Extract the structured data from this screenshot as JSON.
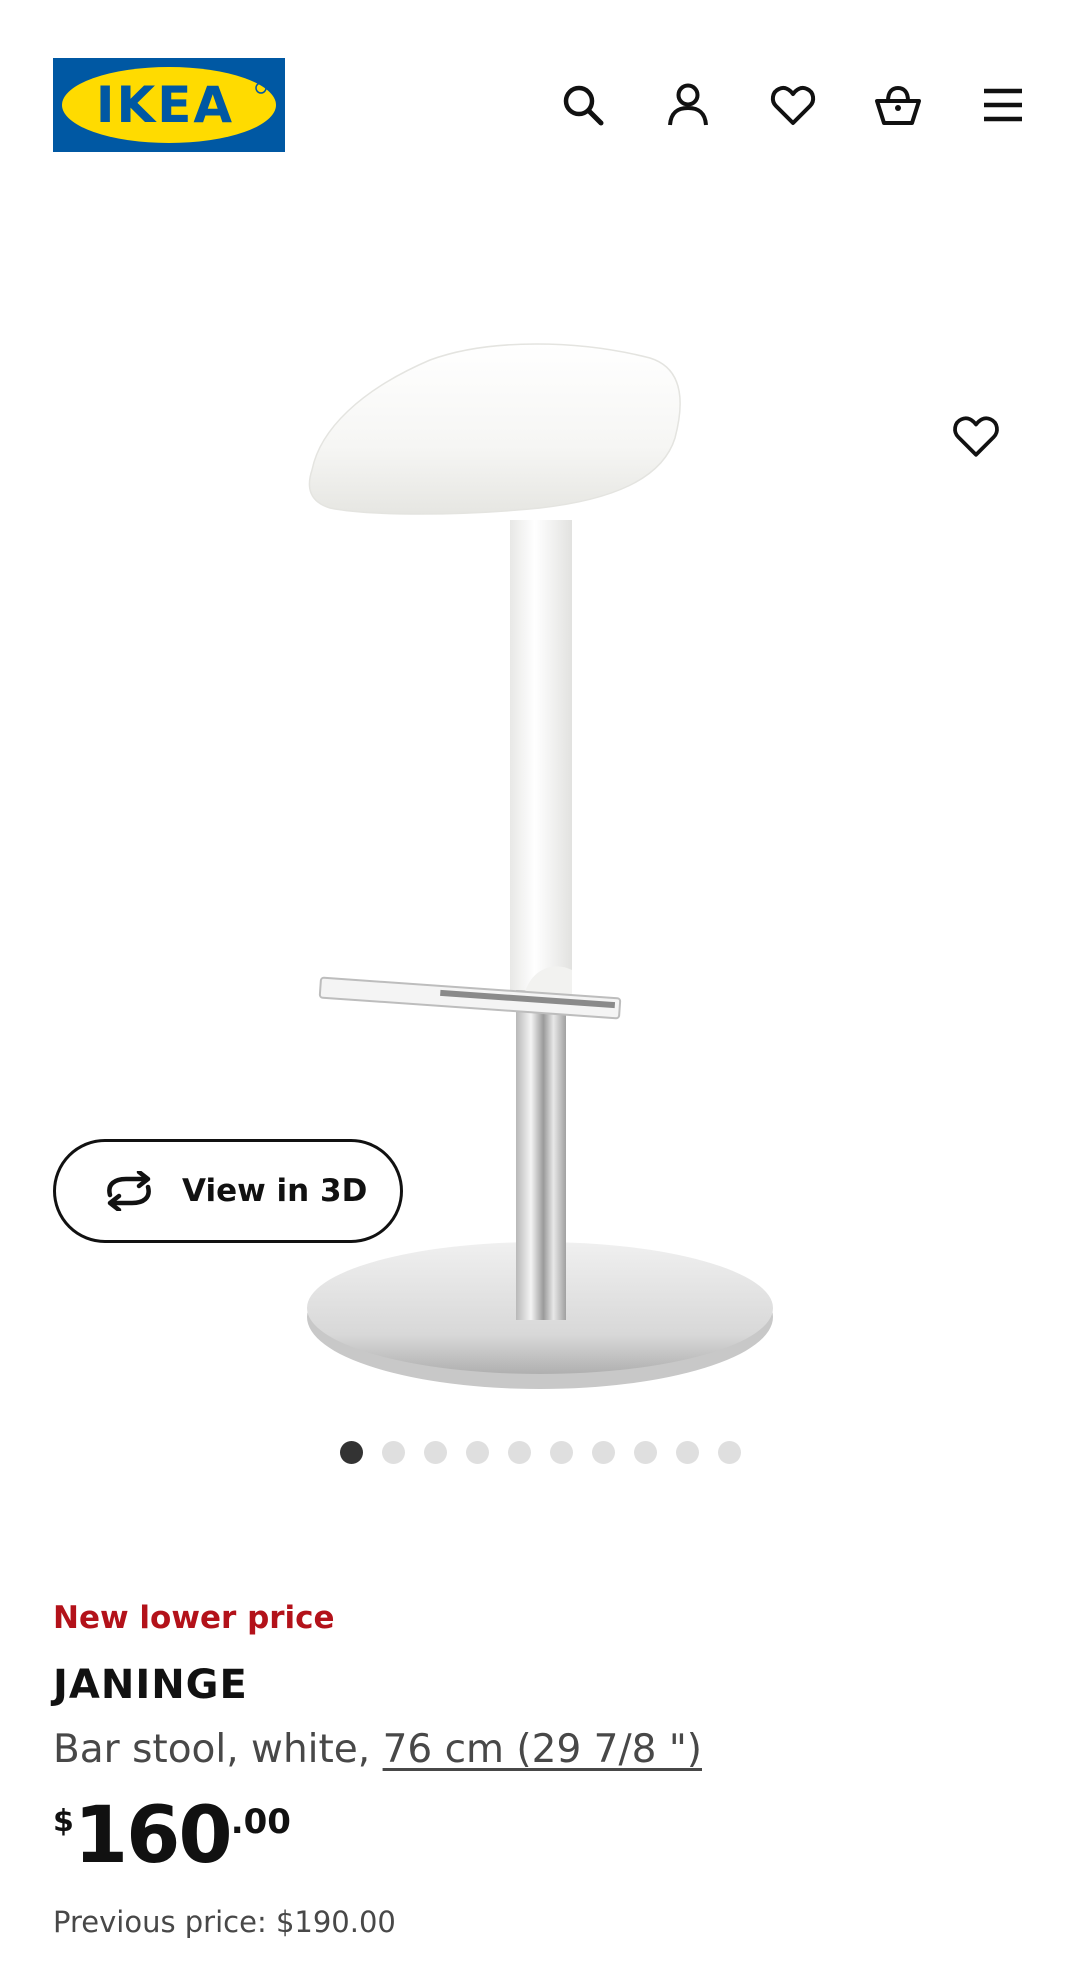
{
  "header": {
    "logo_text": "IKEA",
    "icons": [
      "search-icon",
      "account-icon",
      "heart-icon",
      "shopping-basket-icon",
      "hamburger-menu-icon"
    ]
  },
  "gallery": {
    "view_3d_label": "View in 3D",
    "dot_count": 10,
    "active_index": 0,
    "image_alt_icon": "bar-stool-image"
  },
  "product": {
    "badge": "New lower price",
    "name": "JANINGE",
    "description_prefix": "Bar stool, white, ",
    "size_link": "76 cm (29 7/8 \")",
    "price": {
      "currency": "$",
      "integer": "160",
      "decimal": ".00"
    },
    "previous_price": "Previous price: $190.00"
  },
  "colors": {
    "brand_blue": "#0058a3",
    "brand_yellow": "#ffdb00",
    "promo_red": "#b3121a",
    "active_dot": "#333333",
    "inactive_dot": "#dfdfdf"
  }
}
